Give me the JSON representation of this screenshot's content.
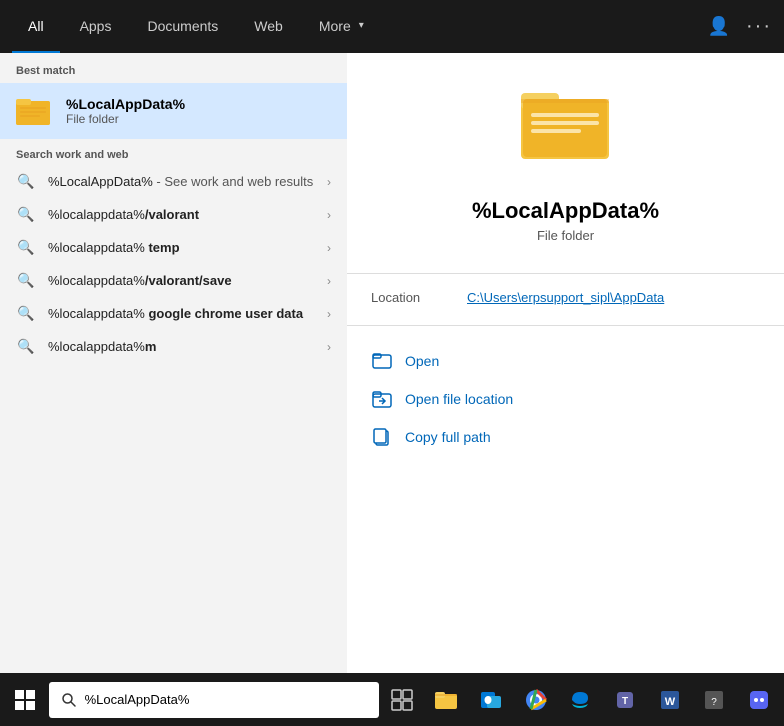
{
  "nav": {
    "tabs": [
      {
        "label": "All",
        "active": true
      },
      {
        "label": "Apps",
        "active": false
      },
      {
        "label": "Documents",
        "active": false
      },
      {
        "label": "Web",
        "active": false
      },
      {
        "label": "More",
        "active": false,
        "hasDropdown": true
      }
    ]
  },
  "left": {
    "best_match_label": "Best match",
    "best_match": {
      "title": "%LocalAppData%",
      "subtitle": "File folder"
    },
    "search_section_label": "Search work and web",
    "search_items": [
      {
        "text_normal": "%LocalAppData%",
        "text_bold": "",
        "suffix": " - See work and web results",
        "parts": [
          {
            "text": "%LocalAppData%",
            "bold": false
          },
          {
            "text": " - See work and web results",
            "bold": false
          }
        ],
        "full_text": "%LocalAppData% - See work and web results"
      },
      {
        "full_text": "%localappdata%/valorant",
        "highlight": "/valorant"
      },
      {
        "full_text": "%localappdata% temp",
        "highlight": " temp"
      },
      {
        "full_text": "%localappdata%/valorant/save",
        "highlight": "/valorant/save"
      },
      {
        "full_text": "%localappdata% google chrome user data",
        "highlight": " google chrome user data"
      },
      {
        "full_text": "%localappdata%m",
        "highlight": "m"
      }
    ]
  },
  "right": {
    "title": "%LocalAppData%",
    "type": "File folder",
    "location_label": "Location",
    "location_path": "C:\\Users\\erpsupport_sipl\\AppData",
    "actions": [
      {
        "label": "Open",
        "icon": "folder-open"
      },
      {
        "label": "Open file location",
        "icon": "folder-location"
      },
      {
        "label": "Copy full path",
        "icon": "copy"
      }
    ]
  },
  "taskbar": {
    "search_value": "%LocalAppData%",
    "search_placeholder": "%LocalAppData%"
  },
  "icons": {
    "search": "⌕",
    "chevron": "›",
    "more_arrow": "▾",
    "user": "👤",
    "ellipsis": "···",
    "windows": "⊞"
  }
}
